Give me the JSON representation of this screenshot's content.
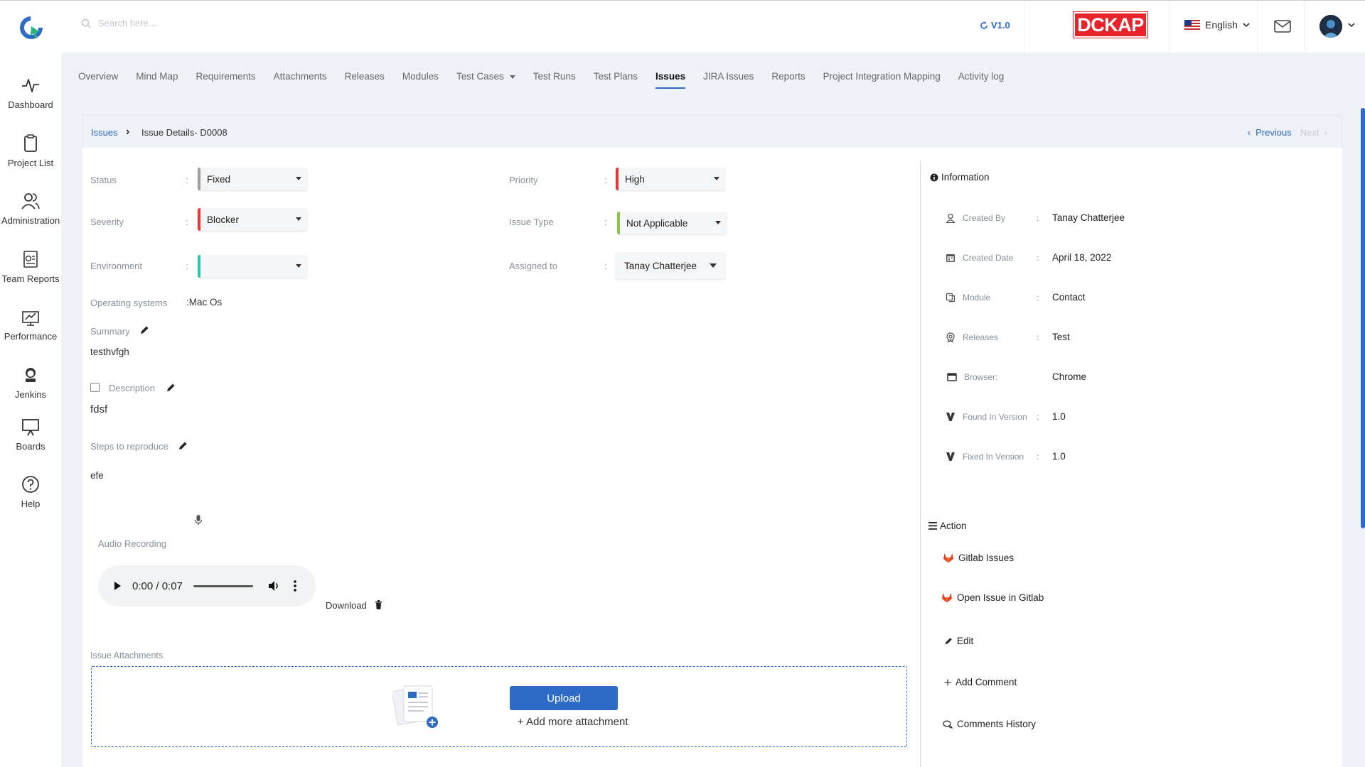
{
  "header": {
    "search_placeholder": "Search here...",
    "version": "V1.0",
    "brand": "DCKAP",
    "language": "English"
  },
  "sidebar": {
    "items": [
      {
        "label": "Dashboard",
        "icon": "activity-icon"
      },
      {
        "label": "Project List",
        "icon": "clipboard-icon"
      },
      {
        "label": "Administration",
        "icon": "users-icon"
      },
      {
        "label": "Team Reports",
        "icon": "report-icon"
      },
      {
        "label": "Performance",
        "icon": "performance-icon"
      },
      {
        "label": "Jenkins",
        "icon": "jenkins-icon"
      },
      {
        "label": "Boards",
        "icon": "board-icon"
      },
      {
        "label": "Help",
        "icon": "help-icon"
      }
    ]
  },
  "tabs": [
    {
      "label": "Overview"
    },
    {
      "label": "Mind Map"
    },
    {
      "label": "Requirements"
    },
    {
      "label": "Attachments"
    },
    {
      "label": "Releases"
    },
    {
      "label": "Modules"
    },
    {
      "label": "Test Cases"
    },
    {
      "label": "Test Runs"
    },
    {
      "label": "Test Plans"
    },
    {
      "label": "Issues",
      "active": true
    },
    {
      "label": "JIRA Issues"
    },
    {
      "label": "Reports"
    },
    {
      "label": "Project Integration Mapping"
    },
    {
      "label": "Activity log"
    }
  ],
  "breadcrumb": {
    "root": "Issues",
    "current": "Issue Details- D0008",
    "previous": "Previous",
    "next": "Next"
  },
  "fields": {
    "status": {
      "label": "Status",
      "value": "Fixed",
      "color": "#9e9e9e"
    },
    "severity": {
      "label": "Severity",
      "value": "Blocker",
      "color": "#e53935"
    },
    "environment": {
      "label": "Environment",
      "value": "",
      "color": "#26c6b4"
    },
    "priority": {
      "label": "Priority",
      "value": "High",
      "color": "#e53935"
    },
    "issue_type": {
      "label": "Issue Type",
      "value": "Not Applicable",
      "color": "#8bc34a"
    },
    "assigned_to": {
      "label": "Assigned to",
      "value": "Tanay Chatterjee"
    },
    "operating_systems": {
      "label": "Operating systems",
      "value": "Mac Os"
    },
    "summary": {
      "label": "Summary",
      "value": "testhvfgh"
    },
    "description": {
      "label": "Description",
      "value": "fdsf"
    },
    "steps": {
      "label": "Steps to reproduce",
      "value": "efe"
    }
  },
  "audio": {
    "label": "Audio Recording",
    "time": "0:00 / 0:07",
    "download": "Download"
  },
  "attachments": {
    "label": "Issue Attachments",
    "upload": "Upload",
    "add_more": "+ Add more attachment"
  },
  "information": {
    "title": "Information",
    "rows": [
      {
        "label": "Created By",
        "value": "Tanay Chatterjee",
        "icon": "user-icon"
      },
      {
        "label": "Created Date",
        "value": "April 18, 2022",
        "icon": "calendar-icon"
      },
      {
        "label": "Module",
        "value": "Contact",
        "icon": "module-icon"
      },
      {
        "label": "Releases",
        "value": "Test",
        "icon": "release-icon"
      },
      {
        "label": "Browser:",
        "value": "Chrome",
        "icon": "browser-icon"
      },
      {
        "label": "Found In Version",
        "value": "1.0",
        "icon": "version-icon"
      },
      {
        "label": "Fixed In Version",
        "value": "1.0",
        "icon": "version-icon"
      }
    ]
  },
  "action": {
    "title": "Action",
    "items": [
      {
        "label": "Gitlab Issues",
        "icon": "gitlab-icon"
      },
      {
        "label": "Open Issue in Gitlab",
        "icon": "gitlab-icon"
      },
      {
        "label": "Edit",
        "icon": "pencil-icon"
      },
      {
        "label": "Add Comment",
        "icon": "plus-icon"
      },
      {
        "label": "Comments History",
        "icon": "comments-icon"
      }
    ]
  },
  "colors": {
    "accent": "#2e6bc6",
    "brand": "#e8242a"
  }
}
